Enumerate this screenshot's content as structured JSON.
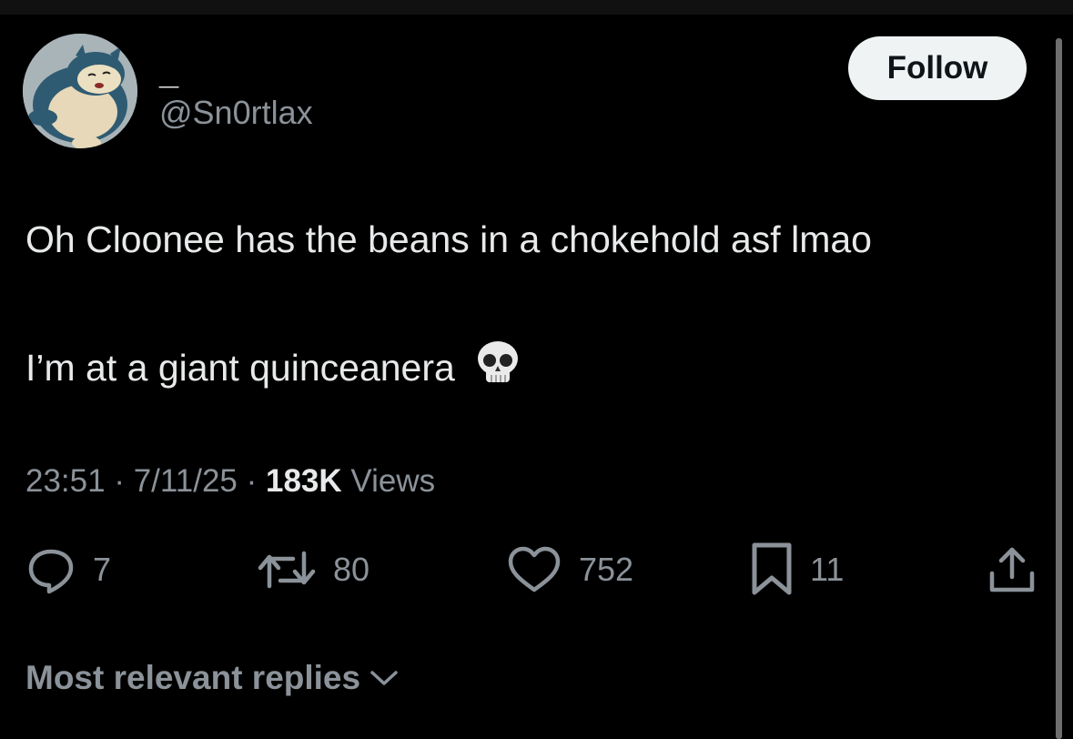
{
  "author": {
    "display_name": "_",
    "handle": "@Sn0rtlax",
    "avatar_icon": "snorlax-avatar"
  },
  "follow_label": "Follow",
  "tweet": {
    "line1": "Oh Cloonee has the beans in a chokehold asf lmao",
    "line2": "I’m at a giant quinceanera",
    "emoji": "skull-emoji"
  },
  "meta": {
    "time": "23:51",
    "sep1": " · ",
    "date": "7/11/25",
    "sep2": " · ",
    "views_count": "183K",
    "views_label": " Views"
  },
  "actions": {
    "replies": "7",
    "reposts": "80",
    "likes": "752",
    "bookmarks": "11"
  },
  "replies_sort": {
    "label": "Most relevant replies"
  },
  "colors": {
    "background": "#000000",
    "text": "#e7e9ea",
    "muted": "#8b9299",
    "follow_bg": "#eff3f4"
  }
}
